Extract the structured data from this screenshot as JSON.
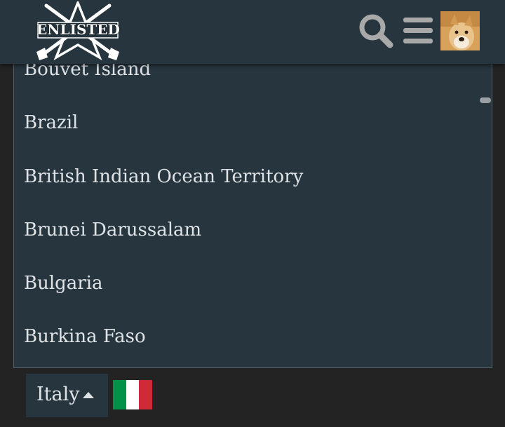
{
  "header": {
    "logo_text": "ENLISTED",
    "icons": [
      "search-icon",
      "menu-icon",
      "avatar"
    ]
  },
  "dropdown": {
    "items": [
      "Bouvet Island",
      "Brazil",
      "British Indian Ocean Territory",
      "Brunei Darussalam",
      "Bulgaria",
      "Burkina Faso"
    ]
  },
  "language_selector": {
    "selected": "Italy",
    "flag_colors": [
      "#009246",
      "#ffffff",
      "#ce2b37"
    ]
  },
  "colors": {
    "header_bg": "#26353e",
    "panel_bg": "#26353e",
    "page_bg": "#232323",
    "text": "#dfe3e6",
    "icon": "#a9a9a9"
  }
}
